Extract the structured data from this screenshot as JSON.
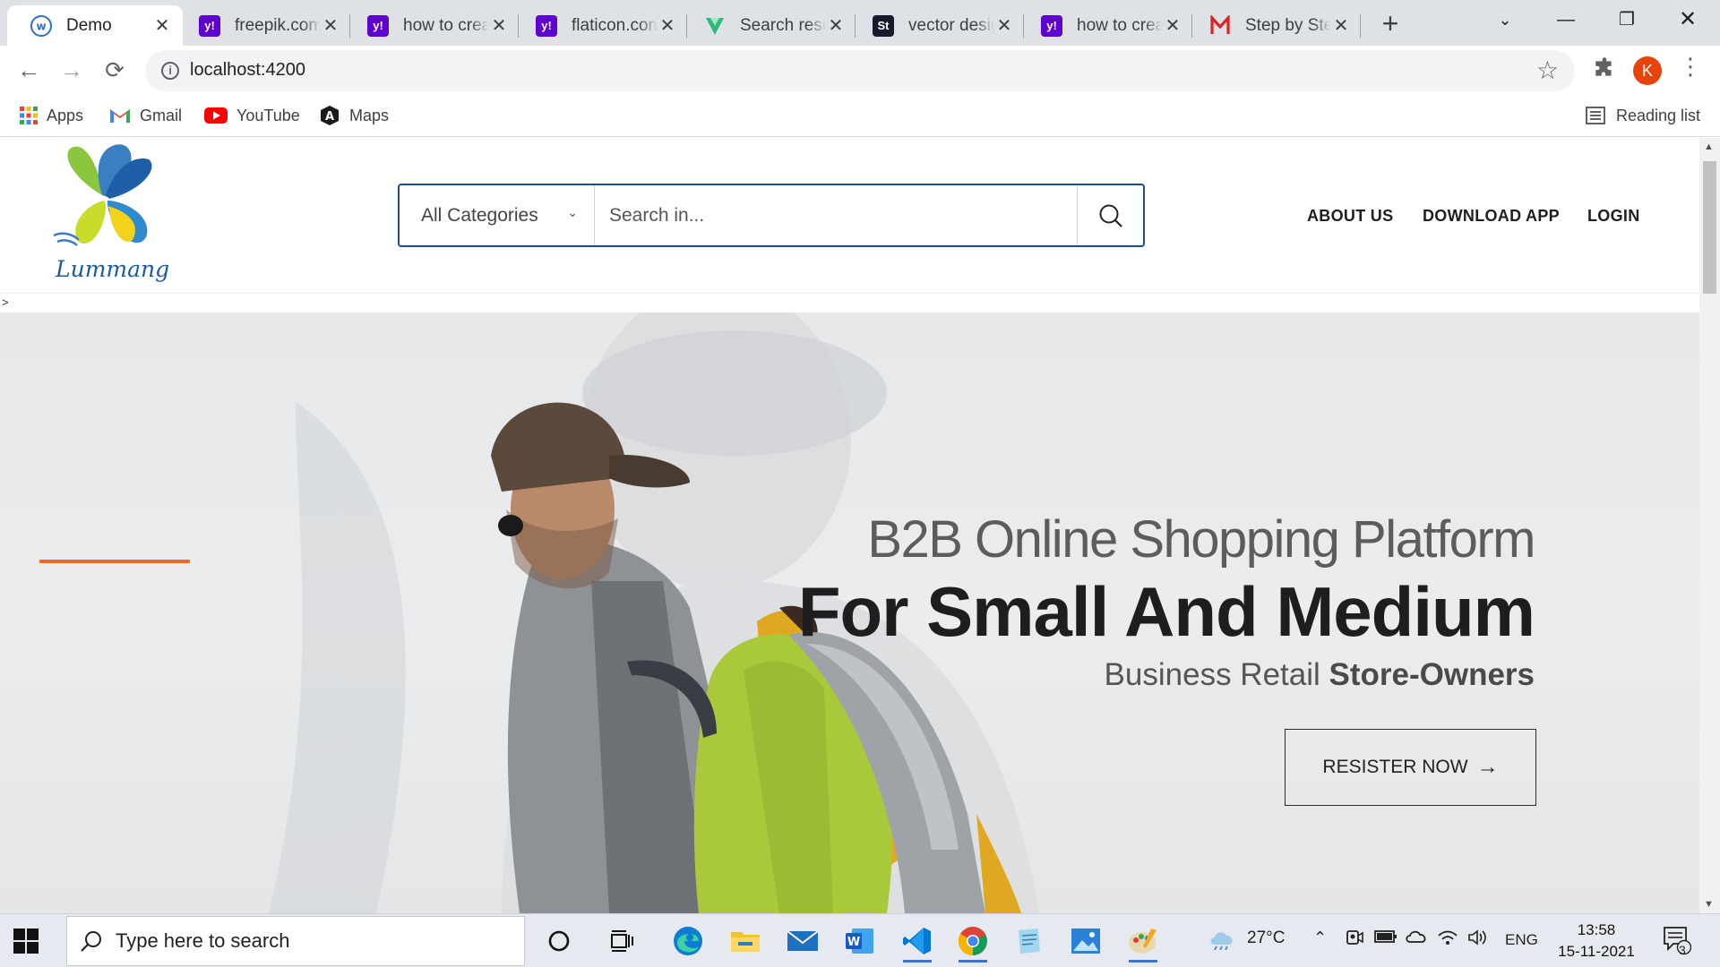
{
  "browser": {
    "tabs": [
      {
        "title": "Demo",
        "icon": "demo-favicon",
        "active": true
      },
      {
        "title": "freepik.com",
        "icon": "yahoo-favicon"
      },
      {
        "title": "how to create",
        "icon": "yahoo-favicon"
      },
      {
        "title": "flaticon.com",
        "icon": "yahoo-favicon"
      },
      {
        "title": "Search results",
        "icon": "vector-favicon"
      },
      {
        "title": "vector design",
        "icon": "stock-favicon"
      },
      {
        "title": "how to create",
        "icon": "yahoo-favicon"
      },
      {
        "title": "Step by Step",
        "icon": "m-favicon"
      }
    ],
    "address": "localhost:4200",
    "profile_initial": "K",
    "bookmarks": [
      {
        "label": "Apps",
        "icon": "apps-grid-icon"
      },
      {
        "label": "Gmail",
        "icon": "gmail-icon"
      },
      {
        "label": "YouTube",
        "icon": "youtube-icon"
      },
      {
        "label": "Maps",
        "icon": "maps-icon"
      }
    ],
    "reading_list": "Reading list"
  },
  "site": {
    "logo_text": "Lummang",
    "search": {
      "category": "All Categories",
      "placeholder": "Search in..."
    },
    "nav": [
      "ABOUT US",
      "DOWNLOAD APP",
      "LOGIN"
    ],
    "stray_text": ">",
    "hero": {
      "title": "B2B Online Shopping Platform",
      "heading": "For Small And Medium",
      "sub_plain": "Business Retail ",
      "sub_bold": "Store-Owners",
      "cta": "RESISTER NOW",
      "accent_color": "#f26722"
    }
  },
  "taskbar": {
    "search_placeholder": "Type here to search",
    "weather": "27°C",
    "language": "ENG",
    "time": "13:58",
    "date": "15-11-2021",
    "notifications": "3"
  }
}
